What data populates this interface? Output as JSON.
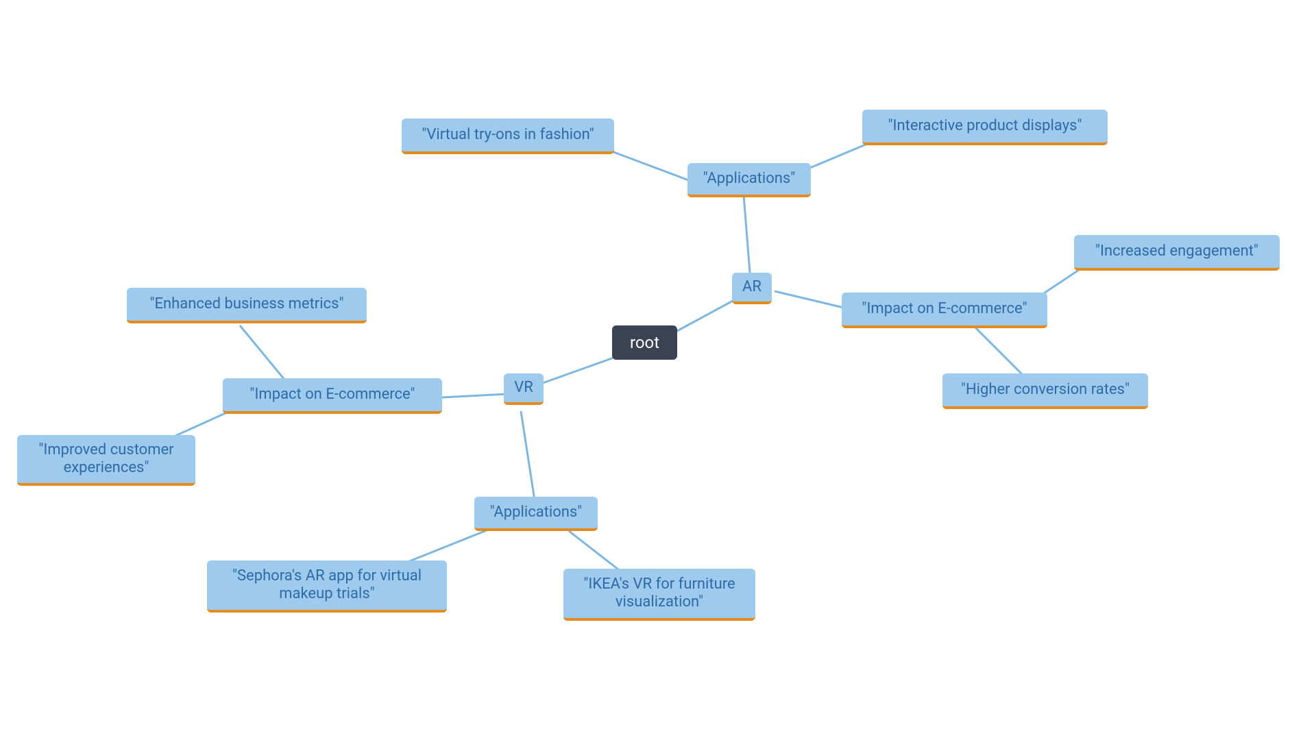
{
  "colors": {
    "root_bg": "#3b4252",
    "root_text": "#ffffff",
    "branch_bg": "#9ecbed",
    "branch_text": "#2f6aa8",
    "branch_underline": "#e38b1e",
    "edge": "#7db7e0"
  },
  "nodes": {
    "root": {
      "label": "root"
    },
    "ar": {
      "label": "AR"
    },
    "vr": {
      "label": "VR"
    },
    "ar_applications": {
      "label": "\"Applications\""
    },
    "ar_app_tryons": {
      "label": "\"Virtual try-ons in fashion\""
    },
    "ar_app_displays": {
      "label": "\"Interactive product displays\""
    },
    "ar_impact": {
      "label": "\"Impact on E-commerce\""
    },
    "ar_impact_engagement": {
      "label": "\"Increased engagement\""
    },
    "ar_impact_conversion": {
      "label": "\"Higher conversion rates\""
    },
    "vr_impact": {
      "label": "\"Impact on E-commerce\""
    },
    "vr_impact_metrics": {
      "label": "\"Enhanced business metrics\""
    },
    "vr_impact_experiences": {
      "label": "\"Improved customer experiences\""
    },
    "vr_applications": {
      "label": "\"Applications\""
    },
    "vr_app_sephora": {
      "label": "\"Sephora's AR app for virtual makeup trials\""
    },
    "vr_app_ikea": {
      "label": "\"IKEA's VR for furniture visualization\""
    }
  }
}
